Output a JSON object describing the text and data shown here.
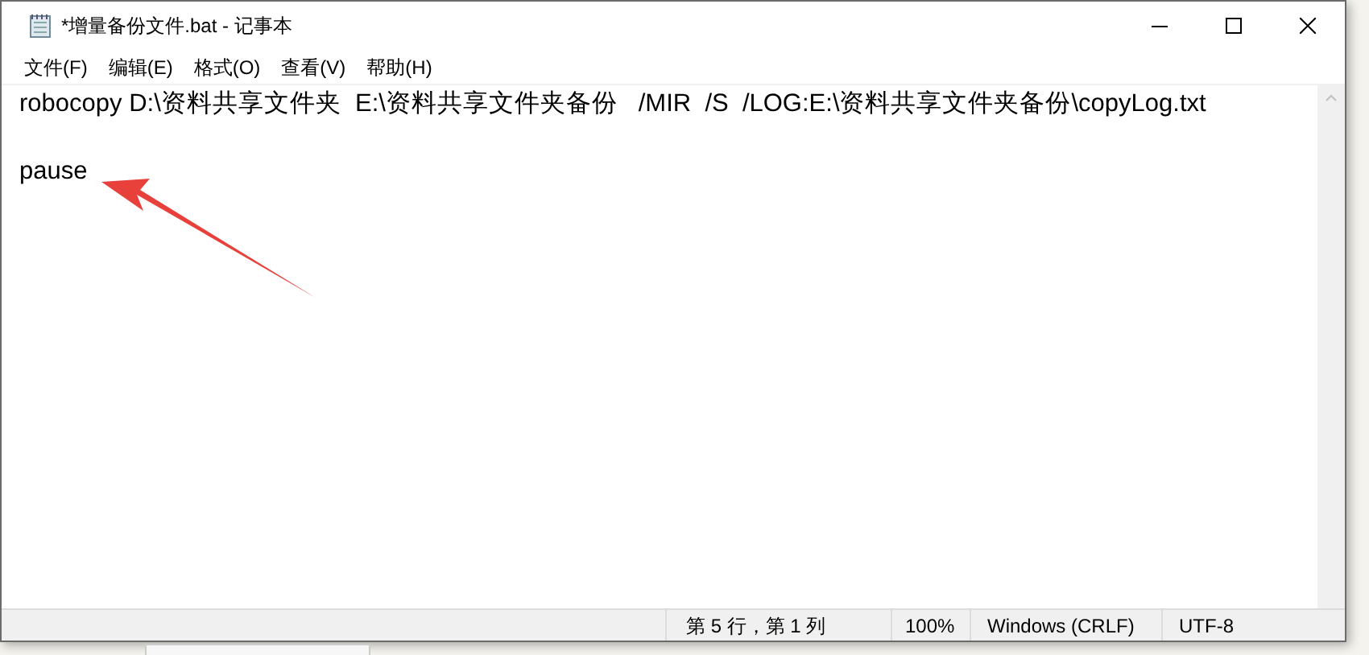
{
  "window": {
    "title": "*增量备份文件.bat - 记事本"
  },
  "menu": [
    {
      "label": "文件(F)"
    },
    {
      "label": "编辑(E)"
    },
    {
      "label": "格式(O)"
    },
    {
      "label": "查看(V)"
    },
    {
      "label": "帮助(H)"
    }
  ],
  "editor": {
    "lines": [
      {
        "kind": "text",
        "text": "robocopy D:\\资料共享文件夹  E:\\资料共享文件夹备份   /MIR  /S  /LOG:E:\\资料共享文件夹备份\\copyLog.txt"
      },
      {
        "kind": "blank"
      },
      {
        "kind": "text",
        "text": "pause"
      }
    ]
  },
  "status_bar": {
    "position": "第 5 行，第 1 列",
    "zoom": "100%",
    "line_ending": "Windows (CRLF)",
    "encoding": "UTF-8"
  }
}
